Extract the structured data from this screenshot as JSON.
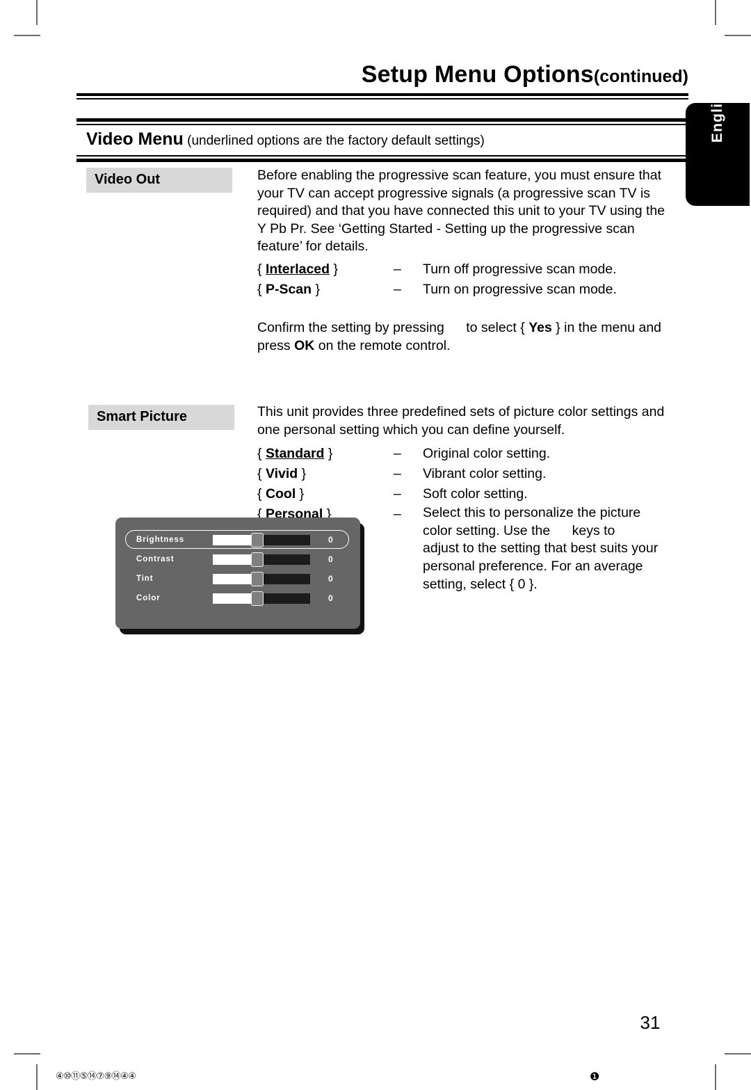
{
  "header": {
    "title_main": "Setup Menu Options",
    "title_continued": "(continued)"
  },
  "section": {
    "title": "Video Menu",
    "subtitle": " (underlined options are the factory default settings)"
  },
  "side_tab": {
    "label": "English"
  },
  "entries": [
    {
      "label": "Video Out",
      "intro": "Before enabling the progressive scan feature, you must ensure that your TV can accept progressive signals (a progressive scan TV is required) and that you have connected this unit to your TV using the Y Pb Pr. See ‘Getting Started - Setting up the progressive scan feature’ for details.",
      "options": [
        {
          "open": "{ ",
          "name": "Interlaced",
          "close": " }",
          "underlined": true,
          "dash": "–",
          "desc": "Turn off progressive scan mode."
        },
        {
          "open": "{ ",
          "name": "P-Scan",
          "close": " }",
          "underlined": false,
          "dash": "–",
          "desc": "Turn on progressive scan mode."
        }
      ],
      "note_part1": "Confirm the setting by pressing",
      "note_part2": "to select {",
      "note_bold1": "Yes",
      "note_part3": "} in the menu and press",
      "note_bold2": "OK",
      "note_part4": "on the remote control."
    },
    {
      "label": "Smart Picture",
      "intro": "This unit provides three predefined sets of picture color settings and one personal setting which you can define yourself.",
      "options": [
        {
          "open": "{ ",
          "name": "Standard",
          "close": " }",
          "underlined": true,
          "dash": "–",
          "desc": "Original color setting."
        },
        {
          "open": "{ ",
          "name": "Vivid",
          "close": " }",
          "underlined": false,
          "dash": "–",
          "desc": "Vibrant color setting."
        },
        {
          "open": "{ ",
          "name": "Cool",
          "close": " }",
          "underlined": false,
          "dash": "–",
          "desc": "Soft color setting."
        },
        {
          "open": "{ ",
          "name": "Personal",
          "close": " }",
          "underlined": false,
          "dash": "–",
          "desc_line1": "Select this to personalize the picture",
          "desc_line2a": "color setting. Use the",
          "desc_line2b": "keys to",
          "desc_line3": "adjust to the setting that best suits your",
          "desc_line4": "personal preference. For an average",
          "desc_line5": "setting, select { 0 }."
        }
      ]
    }
  ],
  "osd": {
    "rows": [
      {
        "label": "Brightness",
        "value": "0",
        "selected": true
      },
      {
        "label": "Contrast",
        "value": "0",
        "selected": false
      },
      {
        "label": "Tint",
        "value": "0",
        "selected": false
      },
      {
        "label": "Color",
        "value": "0",
        "selected": false
      }
    ]
  },
  "footer": {
    "page_number": "31",
    "codes": "④⑩⑪⑤⑭⑦⑨⑭④④",
    "mark": "❶"
  }
}
